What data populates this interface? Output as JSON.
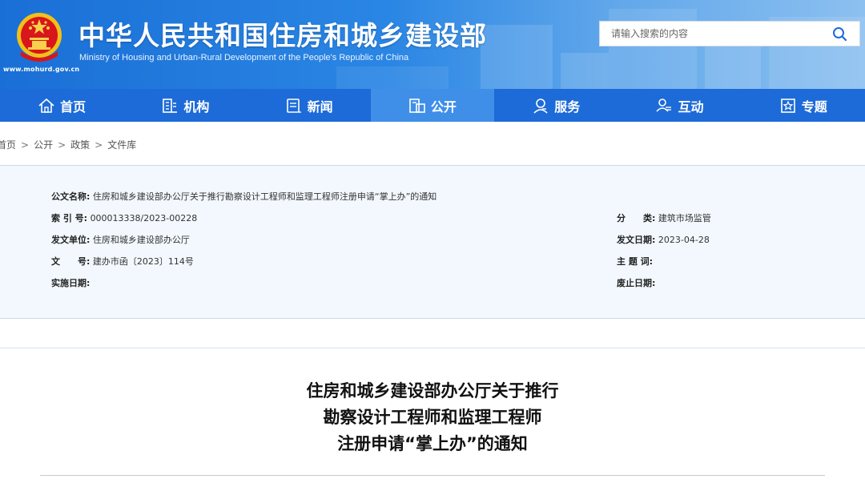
{
  "header": {
    "title_cn": "中华人民共和国住房和城乡建设部",
    "title_en": "Ministry of Housing and Urban-Rural Development of the People's Republic of China",
    "site_url": "www.mohurd.gov.cn",
    "search_placeholder": "请输入搜索的内容",
    "colors": {
      "primary": "#1d6bd8",
      "active": "#3f8fe9",
      "header_start": "#1a6fd6",
      "header_end": "#8cc0f0"
    }
  },
  "nav": {
    "items": [
      {
        "label": "首页",
        "icon": "home-icon"
      },
      {
        "label": "机构",
        "icon": "building-icon"
      },
      {
        "label": "新闻",
        "icon": "news-icon"
      },
      {
        "label": "公开",
        "icon": "document-icon",
        "active": true
      },
      {
        "label": "服务",
        "icon": "service-icon"
      },
      {
        "label": "互动",
        "icon": "interact-icon"
      },
      {
        "label": "专题",
        "icon": "topic-icon"
      }
    ]
  },
  "breadcrumb": [
    "首页",
    "公开",
    "政策",
    "文件库"
  ],
  "meta": {
    "name_label": "公文名称:",
    "name_value": "住房和城乡建设部办公厅关于推行勘察设计工程师和监理工程师注册申请“掌上办”的通知",
    "index_label": "索 引 号:",
    "index_value": "000013338/2023-00228",
    "category_label": "分　　类:",
    "category_value": "建筑市场监管",
    "issuer_label": "发文单位:",
    "issuer_value": "住房和城乡建设部办公厅",
    "date_label": "发文日期:",
    "date_value": "2023-04-28",
    "docno_label": "文　　号:",
    "docno_value": "建办市函〔2023〕114号",
    "keywords_label": "主 题 词:",
    "keywords_value": "",
    "effective_label": "实施日期:",
    "effective_value": "",
    "repeal_label": "废止日期:",
    "repeal_value": ""
  },
  "document": {
    "title_lines": [
      "住房和城乡建设部办公厅关于推行",
      "勘察设计工程师和监理工程师",
      "注册申请“掌上办”的通知"
    ]
  }
}
